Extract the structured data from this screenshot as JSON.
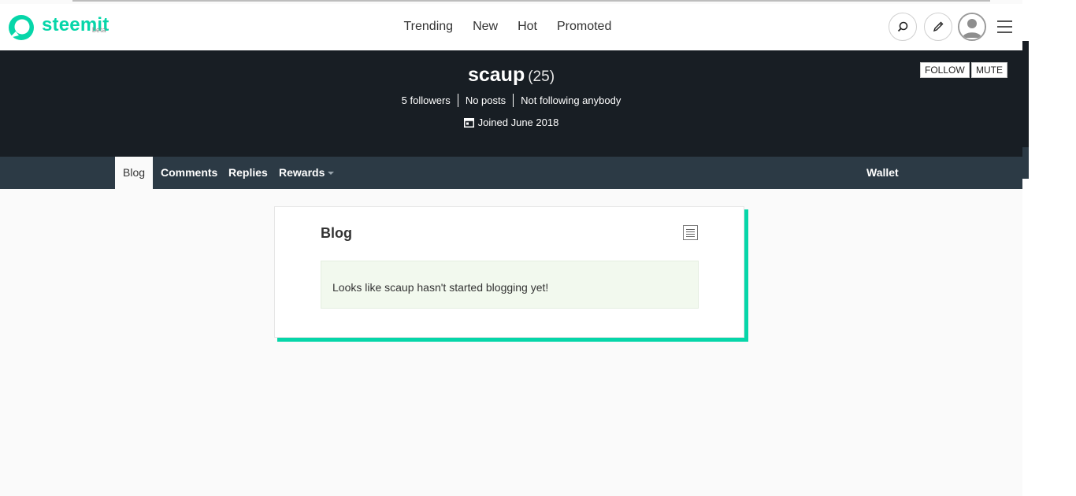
{
  "header": {
    "logo_text": "steemit",
    "logo_beta": "beta",
    "brand_color": "#06d6a9",
    "nav": [
      "Trending",
      "New",
      "Hot",
      "Promoted"
    ],
    "icons": [
      "search-icon",
      "pencil-icon",
      "user-avatar",
      "hamburger-menu-icon"
    ]
  },
  "profile": {
    "name": "scaup",
    "reputation": "(25)",
    "followers": "5 followers",
    "posts": "No posts",
    "following": "Not following anybody",
    "joined": "Joined June 2018",
    "follow_label": "FOLLOW",
    "mute_label": "MUTE"
  },
  "tabs": {
    "items": [
      "Blog",
      "Comments",
      "Replies",
      "Rewards"
    ],
    "active": "Blog",
    "wallet": "Wallet"
  },
  "blog": {
    "title": "Blog",
    "empty_message": "Looks like scaup hasn't started blogging yet!"
  }
}
